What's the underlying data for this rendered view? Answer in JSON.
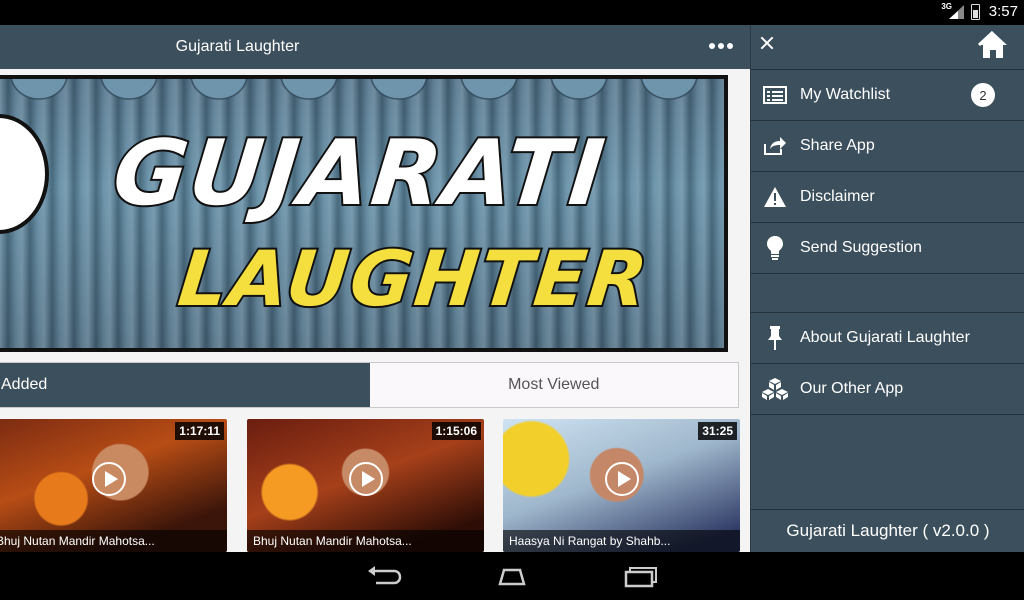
{
  "status_bar": {
    "time": "3:57",
    "network": "3G"
  },
  "app": {
    "title": "Gujarati Laughter",
    "banner": {
      "line1": "GUJARATI",
      "line2": "LAUGHTER"
    },
    "tabs": [
      {
        "label": "Added",
        "active": true
      },
      {
        "label": "Most Viewed",
        "active": false
      }
    ],
    "videos": [
      {
        "duration": "1:17:11",
        "title": "Bhuj Nutan Mandir Mahotsa..."
      },
      {
        "duration": "1:15:06",
        "title": "Bhuj Nutan Mandir Mahotsa..."
      },
      {
        "duration": "31:25",
        "title": "Haasya Ni Rangat by Shahb..."
      }
    ]
  },
  "drawer": {
    "items": [
      {
        "label": "My Watchlist",
        "icon": "list-icon",
        "badge": "2"
      },
      {
        "label": "Share App",
        "icon": "share-icon"
      },
      {
        "label": "Disclaimer",
        "icon": "warning-icon"
      },
      {
        "label": "Send Suggestion",
        "icon": "lightbulb-icon"
      },
      {
        "label": "About Gujarati Laughter",
        "icon": "pin-icon"
      },
      {
        "label": "Our Other App",
        "icon": "cubes-icon"
      }
    ],
    "version": "Gujarati Laughter ( v2.0.0 )"
  },
  "colors": {
    "primary": "#3c4f5c",
    "banner_yellow": "#f4df3e"
  }
}
